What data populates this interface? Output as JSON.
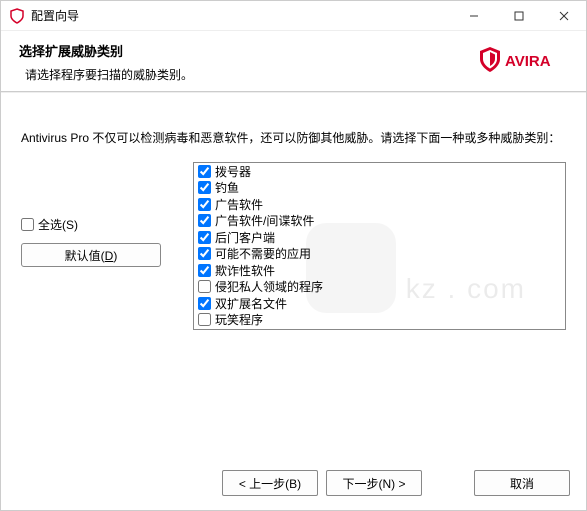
{
  "titlebar": {
    "title": "配置向导"
  },
  "header": {
    "title": "选择扩展威胁类别",
    "subtitle": "请选择程序要扫描的威胁类别。",
    "brand": "AVIRA"
  },
  "content": {
    "intro": "Antivirus Pro 不仅可以检测病毒和恶意软件，还可以防御其他威胁。请选择下面一种或多种威胁类别：",
    "select_all": "全选(S)",
    "default_btn_prefix": "默认值(",
    "default_btn_key": "D",
    "default_btn_suffix": ")",
    "items": [
      {
        "label": "拨号器",
        "checked": true
      },
      {
        "label": "钓鱼",
        "checked": true
      },
      {
        "label": "广告软件",
        "checked": true
      },
      {
        "label": "广告软件/间谍软件",
        "checked": true
      },
      {
        "label": "后门客户端",
        "checked": true
      },
      {
        "label": "可能不需要的应用",
        "checked": true
      },
      {
        "label": "欺诈性软件",
        "checked": true
      },
      {
        "label": "侵犯私人领域的程序",
        "checked": false
      },
      {
        "label": "双扩展名文件",
        "checked": true
      },
      {
        "label": "玩笑程序",
        "checked": false
      }
    ]
  },
  "footer": {
    "back": "< 上一步(B)",
    "next": "下一步(N) >",
    "cancel": "取消"
  },
  "watermark": "kz . com"
}
